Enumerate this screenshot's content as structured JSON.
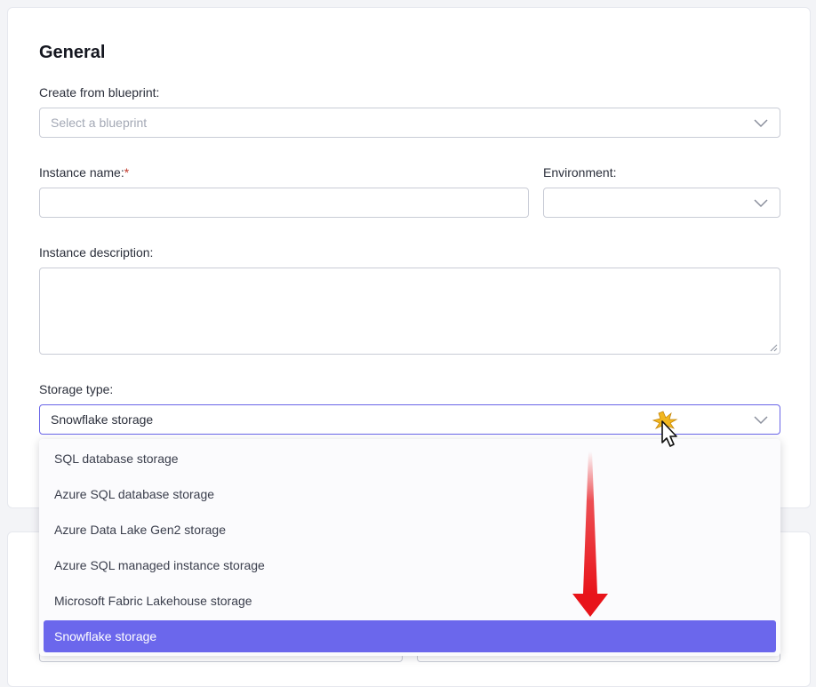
{
  "section": {
    "title": "General"
  },
  "blueprint": {
    "label": "Create from blueprint:",
    "placeholder": "Select a blueprint"
  },
  "instance_name": {
    "label": "Instance name:",
    "required_mark": "*",
    "value": ""
  },
  "environment": {
    "label": "Environment:",
    "value": ""
  },
  "description": {
    "label": "Instance description:",
    "value": ""
  },
  "storage": {
    "label": "Storage type:",
    "selected": "Snowflake storage",
    "options": [
      "SQL database storage",
      "Azure SQL database storage",
      "Azure Data Lake Gen2 storage",
      "Azure SQL managed instance storage",
      "Microsoft Fabric Lakehouse storage",
      "Snowflake storage"
    ],
    "selected_index": 5
  },
  "icons": {
    "dropdown_chevron": "chevron-down-icon",
    "annotation_arrow": "red-arrow-down-icon",
    "cursor": "mouse-pointer-icon"
  },
  "colors": {
    "accent": "#6b67ec",
    "focus_border": "#6a65e8",
    "arrow": "#e8141a",
    "required": "#c0392b"
  }
}
